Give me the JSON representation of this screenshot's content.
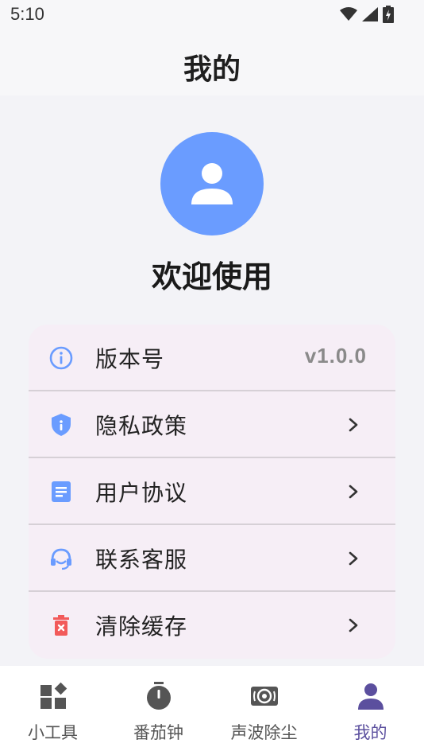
{
  "status_bar": {
    "time": "5:10"
  },
  "header": {
    "title": "我的"
  },
  "profile": {
    "welcome": "欢迎使用"
  },
  "menu": {
    "items": [
      {
        "label": "版本号",
        "value": "v1.0.0",
        "icon": "info-icon"
      },
      {
        "label": "隐私政策",
        "icon": "shield-icon"
      },
      {
        "label": "用户协议",
        "icon": "document-icon"
      },
      {
        "label": "联系客服",
        "icon": "headset-icon"
      },
      {
        "label": "清除缓存",
        "icon": "trash-icon"
      }
    ]
  },
  "bottom_nav": {
    "items": [
      {
        "label": "小工具",
        "icon": "widgets-icon"
      },
      {
        "label": "番茄钟",
        "icon": "timer-icon"
      },
      {
        "label": "声波除尘",
        "icon": "speaker-icon"
      },
      {
        "label": "我的",
        "icon": "person-icon",
        "active": true
      }
    ]
  },
  "colors": {
    "accent": "#6A9CFF",
    "active_nav": "#5B4F9E",
    "card_bg": "#F6EEF6",
    "danger": "#F25A5A"
  }
}
